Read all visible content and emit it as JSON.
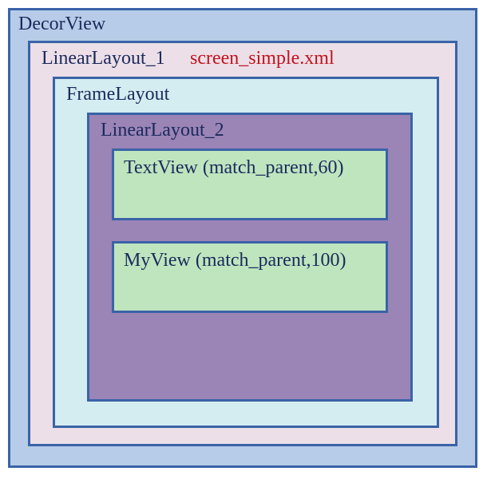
{
  "decorView": {
    "label": "DecorView"
  },
  "linearLayout1": {
    "label": "LinearLayout_1",
    "file": "screen_simple.xml"
  },
  "frameLayout": {
    "label": "FrameLayout"
  },
  "linearLayout2": {
    "label": "LinearLayout_2",
    "children": [
      {
        "label": "TextView (match_parent,60)"
      },
      {
        "label": "MyView (match_parent,100)"
      }
    ]
  }
}
